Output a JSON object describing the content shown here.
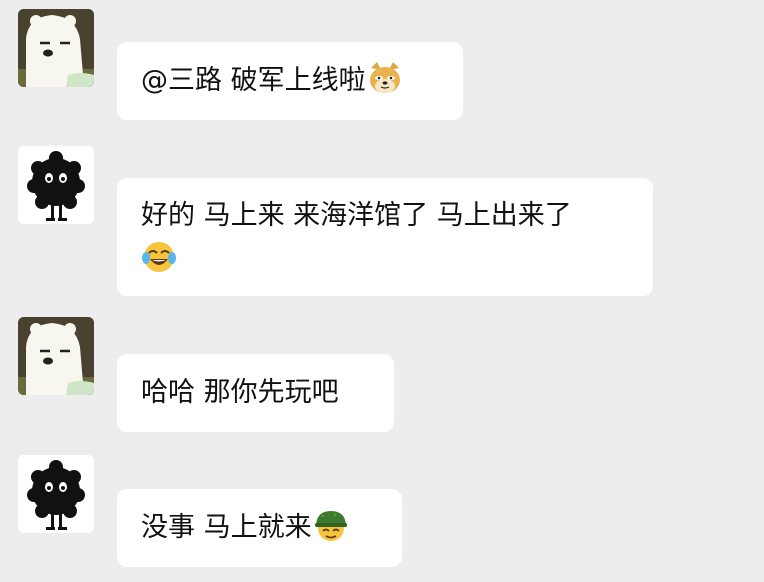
{
  "messages": [
    {
      "sender": "bear",
      "text": "@三路 破军上线啦",
      "emoji": "doge-emoji"
    },
    {
      "sender": "soot",
      "line1": "好的 马上来 来海洋馆了 马上出来了",
      "emoji": "tears-of-joy-emoji"
    },
    {
      "sender": "bear",
      "text": "哈哈 那你先玩吧"
    },
    {
      "sender": "soot",
      "text": "没事 马上就来",
      "emoji": "soldier-helmet-emoji"
    }
  ],
  "colors": {
    "background": "#ededed",
    "bubble": "#ffffff",
    "text": "#111111"
  }
}
